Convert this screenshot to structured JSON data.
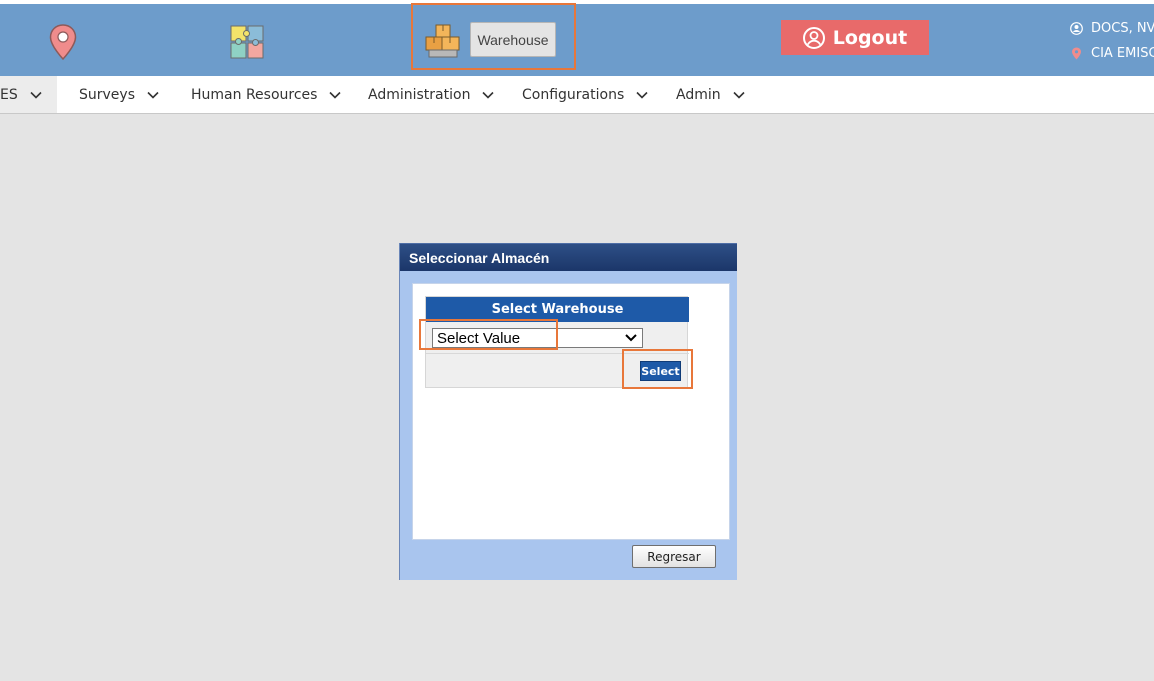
{
  "header": {
    "warehouse_button": "Warehouse",
    "logout_label": "Logout",
    "user_name": "DOCS, NV",
    "company": "CIA EMISC"
  },
  "nav": {
    "items": [
      {
        "label": "ES"
      },
      {
        "label": "Surveys"
      },
      {
        "label": "Human Resources"
      },
      {
        "label": "Administration"
      },
      {
        "label": "Configurations"
      },
      {
        "label": "Admin"
      }
    ]
  },
  "dialog": {
    "title": "Seleccionar Almacén",
    "panel_header": "Select Warehouse",
    "dropdown_value": "Select Value",
    "select_button": "Select",
    "back_button": "Regresar"
  },
  "colors": {
    "header_bg": "#6d9ccb",
    "logout_bg": "#e86a6a",
    "dialog_title_bg": "#1b3669",
    "panel_header_bg": "#1e5aa8",
    "highlight": "#e8773a"
  },
  "icons": {
    "location": "map-pin-icon",
    "puzzle": "puzzle-icon",
    "warehouse": "boxes-icon",
    "logout": "user-circle-icon"
  }
}
